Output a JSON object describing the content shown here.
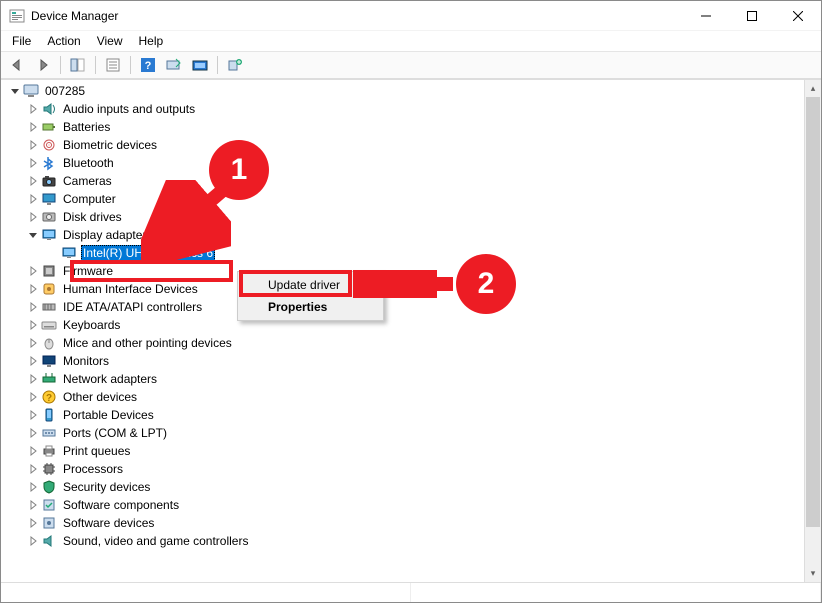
{
  "window": {
    "title": "Device Manager"
  },
  "menubar": {
    "file": "File",
    "action": "Action",
    "view": "View",
    "help": "Help"
  },
  "tree": {
    "root": "007285",
    "categories": [
      {
        "label": "Audio inputs and outputs",
        "icon": "audio"
      },
      {
        "label": "Batteries",
        "icon": "battery"
      },
      {
        "label": "Biometric devices",
        "icon": "biometric"
      },
      {
        "label": "Bluetooth",
        "icon": "bluetooth"
      },
      {
        "label": "Cameras",
        "icon": "camera"
      },
      {
        "label": "Computer",
        "icon": "computer"
      },
      {
        "label": "Disk drives",
        "icon": "disk"
      },
      {
        "label": "Display adapters",
        "icon": "display",
        "expanded": true,
        "children": [
          {
            "label": "Intel(R) UHD Graphics 6",
            "icon": "display",
            "selected": true
          }
        ]
      },
      {
        "label": "Firmware",
        "icon": "firmware"
      },
      {
        "label": "Human Interface Devices",
        "icon": "hid"
      },
      {
        "label": "IDE ATA/ATAPI controllers",
        "icon": "ide"
      },
      {
        "label": "Keyboards",
        "icon": "keyboard"
      },
      {
        "label": "Mice and other pointing devices",
        "icon": "mouse"
      },
      {
        "label": "Monitors",
        "icon": "monitor"
      },
      {
        "label": "Network adapters",
        "icon": "network"
      },
      {
        "label": "Other devices",
        "icon": "unknown"
      },
      {
        "label": "Portable Devices",
        "icon": "portable"
      },
      {
        "label": "Ports (COM & LPT)",
        "icon": "port"
      },
      {
        "label": "Print queues",
        "icon": "printer"
      },
      {
        "label": "Processors",
        "icon": "cpu"
      },
      {
        "label": "Security devices",
        "icon": "security"
      },
      {
        "label": "Software components",
        "icon": "swcomp"
      },
      {
        "label": "Software devices",
        "icon": "swdev"
      },
      {
        "label": "Sound, video and game controllers",
        "icon": "sound",
        "cutoff": true
      }
    ]
  },
  "context_menu": {
    "update": "Update driver",
    "properties": "Properties"
  },
  "annotations": {
    "step1": "1",
    "step2": "2"
  }
}
